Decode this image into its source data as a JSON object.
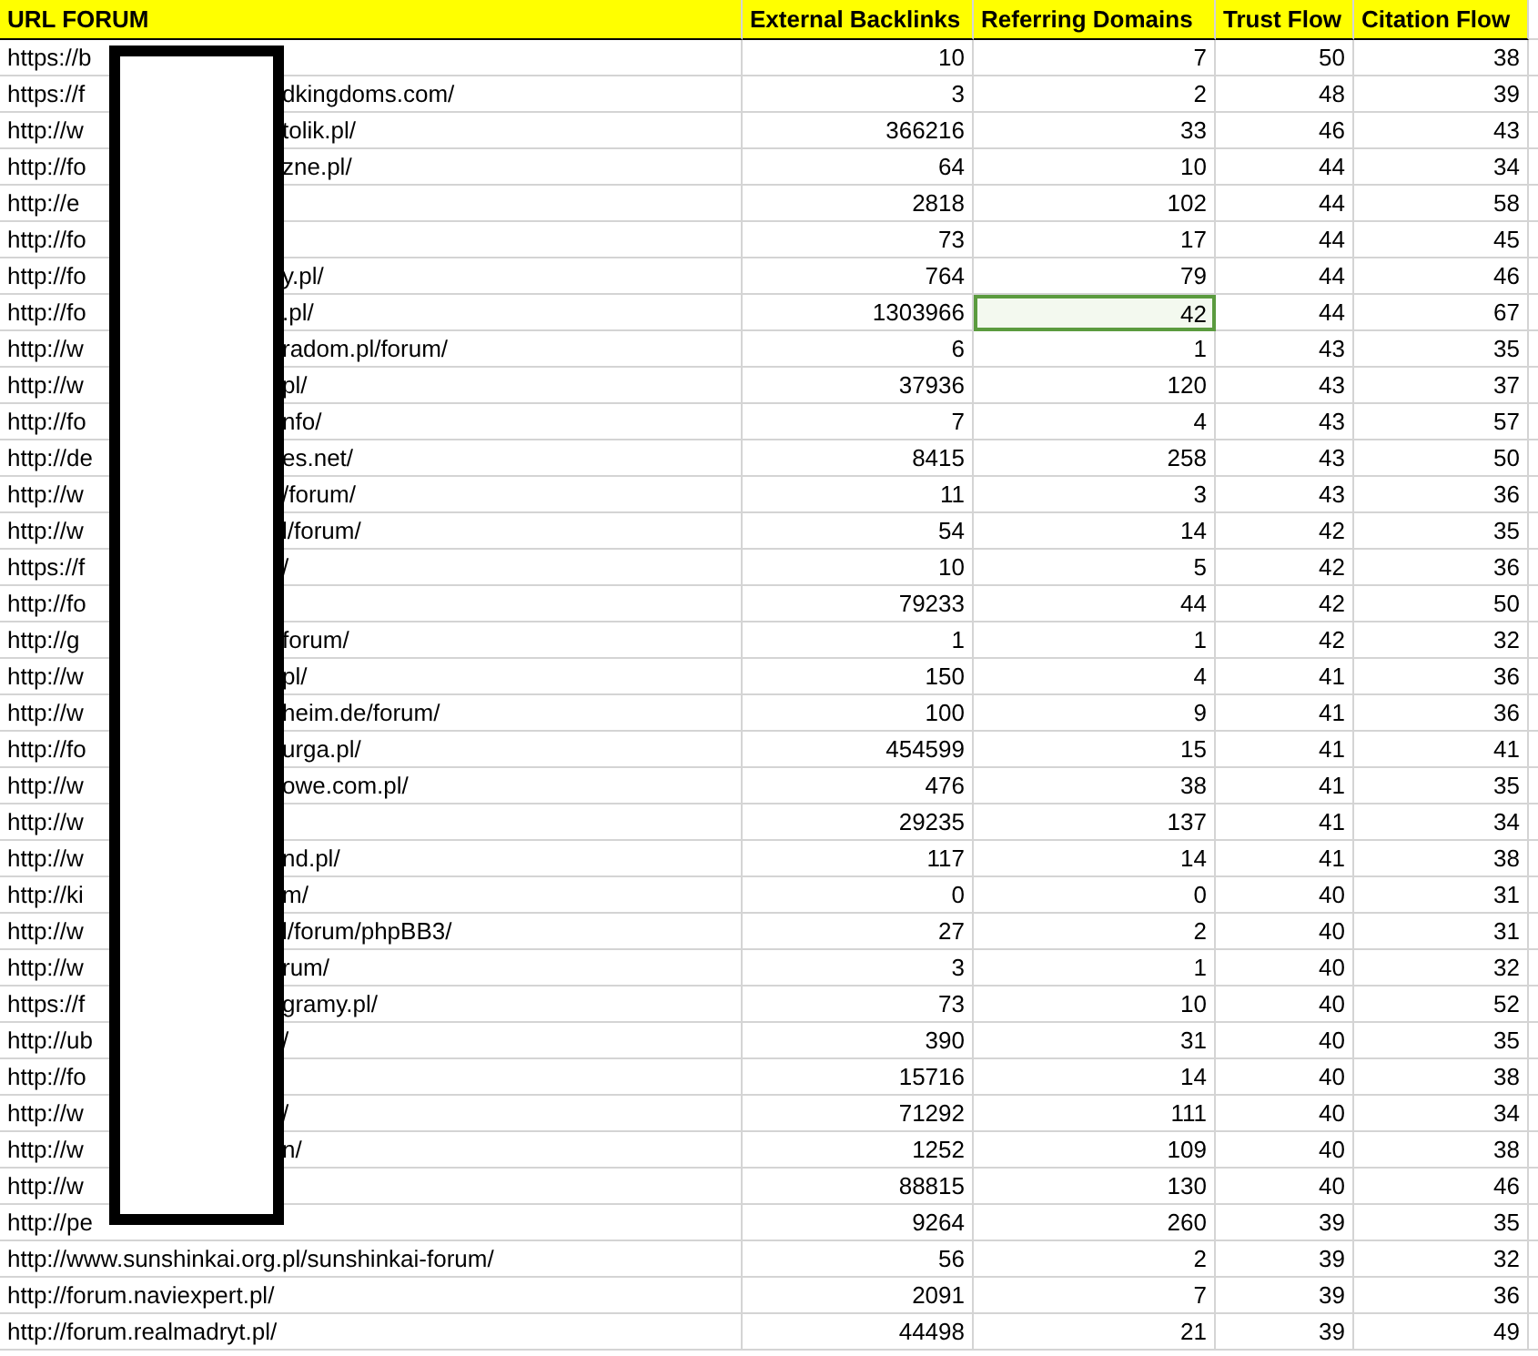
{
  "columns": [
    "URL FORUM",
    "External Backlinks",
    "Referring Domains",
    "Trust Flow",
    "Citation Flow"
  ],
  "rows": [
    {
      "url_start": "https://b",
      "url_end": "",
      "backlinks": "10",
      "domains": "7",
      "trust": "50",
      "citation": "38",
      "selected": false
    },
    {
      "url_start": "https://f",
      "url_end": "dkingdoms.com/",
      "backlinks": "3",
      "domains": "2",
      "trust": "48",
      "citation": "39",
      "selected": false
    },
    {
      "url_start": "http://w",
      "url_end": "tolik.pl/",
      "backlinks": "366216",
      "domains": "33",
      "trust": "46",
      "citation": "43",
      "selected": false
    },
    {
      "url_start": "http://fo",
      "url_end": "zne.pl/",
      "backlinks": "64",
      "domains": "10",
      "trust": "44",
      "citation": "34",
      "selected": false
    },
    {
      "url_start": "http://e",
      "url_end": "",
      "backlinks": "2818",
      "domains": "102",
      "trust": "44",
      "citation": "58",
      "selected": false
    },
    {
      "url_start": "http://fo",
      "url_end": "",
      "backlinks": "73",
      "domains": "17",
      "trust": "44",
      "citation": "45",
      "selected": false
    },
    {
      "url_start": "http://fo",
      "url_end": "y.pl/",
      "backlinks": "764",
      "domains": "79",
      "trust": "44",
      "citation": "46",
      "selected": false
    },
    {
      "url_start": "http://fo",
      "url_end": ".pl/",
      "backlinks": "1303966",
      "domains": "42",
      "trust": "44",
      "citation": "67",
      "selected": true
    },
    {
      "url_start": "http://w",
      "url_end": "radom.pl/forum/",
      "backlinks": "6",
      "domains": "1",
      "trust": "43",
      "citation": "35",
      "selected": false
    },
    {
      "url_start": "http://w",
      "url_end": "pl/",
      "backlinks": "37936",
      "domains": "120",
      "trust": "43",
      "citation": "37",
      "selected": false
    },
    {
      "url_start": "http://fo",
      "url_end": "nfo/",
      "backlinks": "7",
      "domains": "4",
      "trust": "43",
      "citation": "57",
      "selected": false
    },
    {
      "url_start": "http://de",
      "url_end": "es.net/",
      "backlinks": "8415",
      "domains": "258",
      "trust": "43",
      "citation": "50",
      "selected": false
    },
    {
      "url_start": "http://w",
      "url_end": "/forum/",
      "backlinks": "11",
      "domains": "3",
      "trust": "43",
      "citation": "36",
      "selected": false
    },
    {
      "url_start": "http://w",
      "url_end": "l/forum/",
      "backlinks": "54",
      "domains": "14",
      "trust": "42",
      "citation": "35",
      "selected": false
    },
    {
      "url_start": "https://f",
      "url_end": "/",
      "backlinks": "10",
      "domains": "5",
      "trust": "42",
      "citation": "36",
      "selected": false
    },
    {
      "url_start": "http://fo",
      "url_end": "",
      "backlinks": "79233",
      "domains": "44",
      "trust": "42",
      "citation": "50",
      "selected": false
    },
    {
      "url_start": "http://g",
      "url_end": "forum/",
      "backlinks": "1",
      "domains": "1",
      "trust": "42",
      "citation": "32",
      "selected": false
    },
    {
      "url_start": "http://w",
      "url_end": "pl/",
      "backlinks": "150",
      "domains": "4",
      "trust": "41",
      "citation": "36",
      "selected": false
    },
    {
      "url_start": "http://w",
      "url_end": "heim.de/forum/",
      "backlinks": "100",
      "domains": "9",
      "trust": "41",
      "citation": "36",
      "selected": false
    },
    {
      "url_start": "http://fo",
      "url_end": "urga.pl/",
      "backlinks": "454599",
      "domains": "15",
      "trust": "41",
      "citation": "41",
      "selected": false
    },
    {
      "url_start": "http://w",
      "url_end": "owe.com.pl/",
      "backlinks": "476",
      "domains": "38",
      "trust": "41",
      "citation": "35",
      "selected": false
    },
    {
      "url_start": "http://w",
      "url_end": "",
      "backlinks": "29235",
      "domains": "137",
      "trust": "41",
      "citation": "34",
      "selected": false
    },
    {
      "url_start": "http://w",
      "url_end": "nd.pl/",
      "backlinks": "117",
      "domains": "14",
      "trust": "41",
      "citation": "38",
      "selected": false
    },
    {
      "url_start": "http://ki",
      "url_end": "m/",
      "backlinks": "0",
      "domains": "0",
      "trust": "40",
      "citation": "31",
      "selected": false
    },
    {
      "url_start": "http://w",
      "url_end": "l/forum/phpBB3/",
      "backlinks": "27",
      "domains": "2",
      "trust": "40",
      "citation": "31",
      "selected": false
    },
    {
      "url_start": "http://w",
      "url_end": "rum/",
      "backlinks": "3",
      "domains": "1",
      "trust": "40",
      "citation": "32",
      "selected": false
    },
    {
      "url_start": "https://f",
      "url_end": "gramy.pl/",
      "backlinks": "73",
      "domains": "10",
      "trust": "40",
      "citation": "52",
      "selected": false
    },
    {
      "url_start": "http://ub",
      "url_end": "/",
      "backlinks": "390",
      "domains": "31",
      "trust": "40",
      "citation": "35",
      "selected": false
    },
    {
      "url_start": "http://fo",
      "url_end": "",
      "backlinks": "15716",
      "domains": "14",
      "trust": "40",
      "citation": "38",
      "selected": false
    },
    {
      "url_start": "http://w",
      "url_end": "/",
      "backlinks": "71292",
      "domains": "111",
      "trust": "40",
      "citation": "34",
      "selected": false
    },
    {
      "url_start": "http://w",
      "url_end": "n/",
      "backlinks": "1252",
      "domains": "109",
      "trust": "40",
      "citation": "38",
      "selected": false
    },
    {
      "url_start": "http://w",
      "url_end": "",
      "backlinks": "88815",
      "domains": "130",
      "trust": "40",
      "citation": "46",
      "selected": false
    },
    {
      "url_start": "http://pe",
      "url_end": "",
      "backlinks": "9264",
      "domains": "260",
      "trust": "39",
      "citation": "35",
      "selected": false
    },
    {
      "url_start": "http://www.sunshinkai.org.pl/sunshinkai-forum/",
      "url_end": "",
      "backlinks": "56",
      "domains": "2",
      "trust": "39",
      "citation": "32",
      "selected": false
    },
    {
      "url_start": "http://forum.naviexpert.pl/",
      "url_end": "",
      "backlinks": "2091",
      "domains": "7",
      "trust": "39",
      "citation": "36",
      "selected": false
    },
    {
      "url_start": "http://forum.realmadryt.pl/",
      "url_end": "",
      "backlinks": "44498",
      "domains": "21",
      "trust": "39",
      "citation": "49",
      "selected": false
    }
  ]
}
